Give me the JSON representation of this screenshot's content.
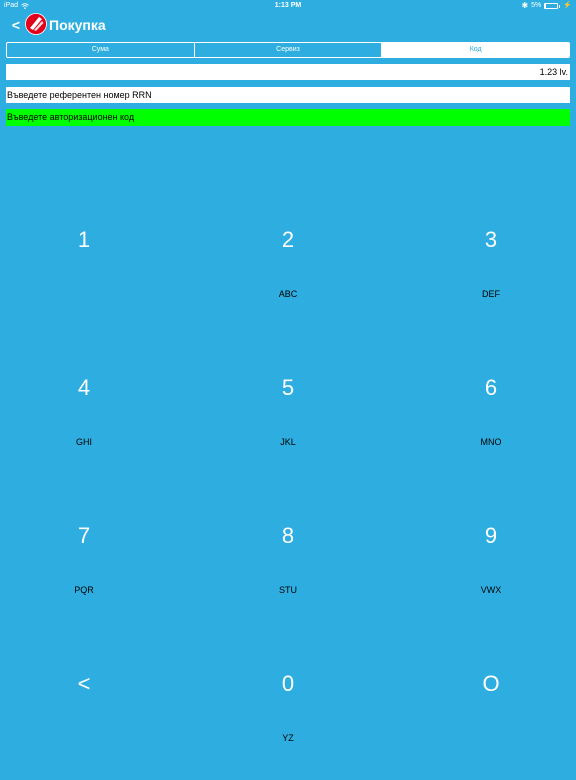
{
  "status_bar": {
    "device": "iPad",
    "time": "1:13 PM",
    "battery": "5%",
    "icons": [
      "wifi-icon",
      "bluetooth-icon",
      "battery-icon",
      "charging-icon"
    ]
  },
  "nav": {
    "back_label": "<",
    "title": "Покупка",
    "logo_icon": "bank-logo-icon"
  },
  "tabs": [
    {
      "label": "Сума",
      "selected": false
    },
    {
      "label": "Сервиз",
      "selected": false
    },
    {
      "label": "Код",
      "selected": true
    }
  ],
  "fields": {
    "amount": "1.23 lv.",
    "rrn_prompt": "Въведете референтен номер RRN",
    "auth_prompt": "Въведете авторизационен код"
  },
  "keypad": [
    {
      "digit": "1",
      "letters": ""
    },
    {
      "digit": "2",
      "letters": "ABC"
    },
    {
      "digit": "3",
      "letters": "DEF"
    },
    {
      "digit": "4",
      "letters": "GHI"
    },
    {
      "digit": "5",
      "letters": "JKL"
    },
    {
      "digit": "6",
      "letters": "MNO"
    },
    {
      "digit": "7",
      "letters": "PQR"
    },
    {
      "digit": "8",
      "letters": "STU"
    },
    {
      "digit": "9",
      "letters": "VWX"
    },
    {
      "digit": "<",
      "letters": ""
    },
    {
      "digit": "0",
      "letters": "YZ"
    },
    {
      "digit": "O",
      "letters": ""
    }
  ],
  "colors": {
    "background": "#2eaee0",
    "text_primary": "#ffffff",
    "field_background": "#ffffff",
    "active_field_background": "#00ff00",
    "logo_red": "#e2001a"
  }
}
